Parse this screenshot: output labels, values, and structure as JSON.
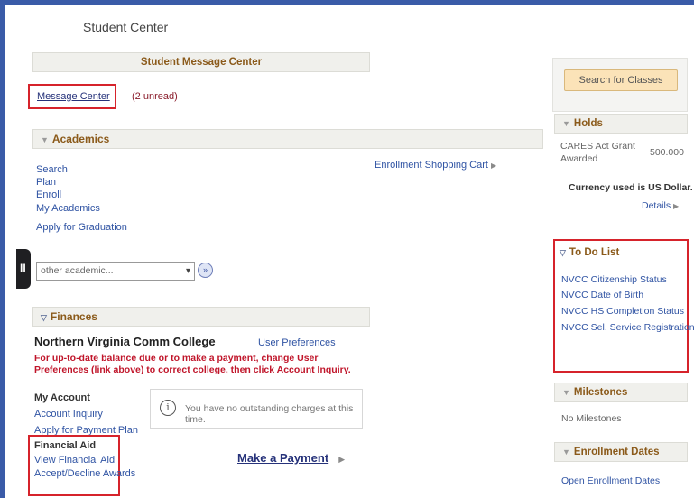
{
  "page": {
    "title": "Student Center"
  },
  "message_center": {
    "banner": "Student Message Center",
    "link": "Message Center",
    "unread": "(2 unread)"
  },
  "academics": {
    "header": "Academics",
    "links": [
      "Search",
      "Plan",
      "Enroll",
      "My Academics"
    ],
    "apply_graduation": "Apply for Graduation",
    "shopping_cart": "Enrollment Shopping Cart",
    "select_value": "other academic..."
  },
  "finances": {
    "header": "Finances",
    "college": "Northern Virginia Comm College",
    "user_prefs": "User Preferences",
    "notice": "For up-to-date balance due or to make a payment, change User Preferences (link above) to correct college, then click Account Inquiry.",
    "my_account_label": "My Account",
    "account_inquiry": "Account Inquiry",
    "payment_plan": "Apply for Payment Plan",
    "financial_aid_label": "Financial Aid",
    "view_financial_aid": "View Financial Aid",
    "accept_decline": "Accept/Decline Awards",
    "no_charges": "You have no outstanding charges at this time.",
    "make_payment": "Make a Payment"
  },
  "search_classes": "Search for Classes",
  "holds": {
    "header": "Holds",
    "item_name_line1": "CARES Act Grant",
    "item_name_line2": "Awarded",
    "item_amount": "500.000",
    "currency_note": "Currency used is US Dollar.",
    "details": "Details"
  },
  "todo": {
    "header": "To Do List",
    "items": [
      "NVCC Citizenship Status",
      "NVCC Date of Birth",
      "NVCC HS Completion Status",
      "NVCC Sel. Service Registration"
    ]
  },
  "milestones": {
    "header": "Milestones",
    "text": "No Milestones"
  },
  "enrollment_dates": {
    "header": "Enrollment Dates",
    "link": "Open Enrollment Dates"
  },
  "colors": {
    "accent_brown": "#8b5a1a",
    "link_blue": "#2f53a3",
    "highlight_red": "#d6232b",
    "notice_red": "#c0152a",
    "search_button": "#fbe3b8"
  },
  "icons": {
    "collapse": "triangle-down-icon",
    "arrow": "triangle-right-icon",
    "info": "info-circle-icon",
    "go": "double-chevron-right-icon"
  }
}
